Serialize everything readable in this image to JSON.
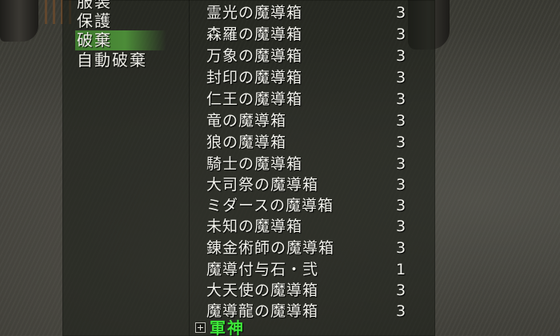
{
  "category_menu": {
    "items": [
      {
        "label": "服装",
        "selected": false
      },
      {
        "label": "保護",
        "selected": false
      },
      {
        "label": "破棄",
        "selected": true
      },
      {
        "label": "自動破棄",
        "selected": false
      }
    ]
  },
  "item_list": {
    "rows": [
      {
        "name": "霊光の魔導箱",
        "qty": "3"
      },
      {
        "name": "森羅の魔導箱",
        "qty": "3"
      },
      {
        "name": "万象の魔導箱",
        "qty": "3"
      },
      {
        "name": "封印の魔導箱",
        "qty": "3"
      },
      {
        "name": "仁王の魔導箱",
        "qty": "3"
      },
      {
        "name": "竜の魔導箱",
        "qty": "3"
      },
      {
        "name": "狼の魔導箱",
        "qty": "3"
      },
      {
        "name": "騎士の魔導箱",
        "qty": "3"
      },
      {
        "name": "大司祭の魔導箱",
        "qty": "3"
      },
      {
        "name": "ミダースの魔導箱",
        "qty": "3"
      },
      {
        "name": "未知の魔導箱",
        "qty": "3"
      },
      {
        "name": "錬金術師の魔導箱",
        "qty": "3"
      },
      {
        "name": "魔導付与石・弐",
        "qty": "1"
      },
      {
        "name": "大天使の魔導箱",
        "qty": "3"
      },
      {
        "name": "魔導龍の魔導箱",
        "qty": "3"
      }
    ],
    "group_header": {
      "label": "軍神",
      "icon": "expand-plus-icon"
    }
  },
  "colors": {
    "selected_highlight": "#4c8c38",
    "group_header_text": "#3ee83a",
    "text": "#f2f2ec"
  }
}
